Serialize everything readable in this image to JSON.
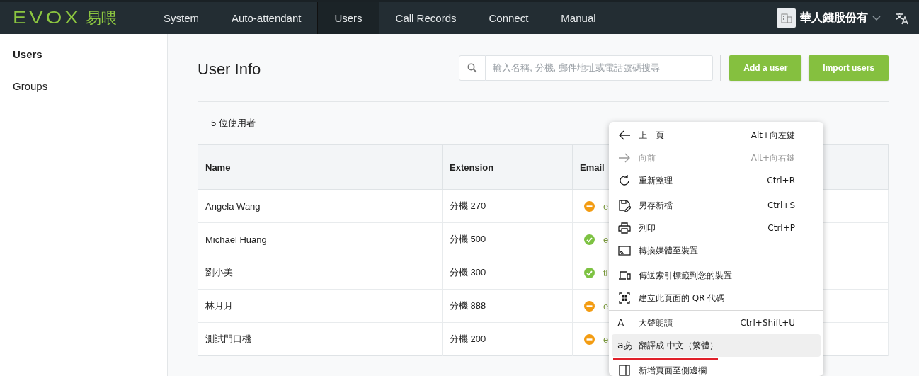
{
  "nav": {
    "logo": "EVOX",
    "logo_sub": "易喂",
    "tabs": [
      {
        "label": "System",
        "selected": false
      },
      {
        "label": "Auto-attendant",
        "selected": false
      },
      {
        "label": "Users",
        "selected": true
      },
      {
        "label": "Call Records",
        "selected": false
      },
      {
        "label": "Connect",
        "selected": false
      },
      {
        "label": "Manual",
        "selected": false
      }
    ],
    "company": "華人錢股份有"
  },
  "sidebar": {
    "items": [
      {
        "label": "Users",
        "selected": true
      },
      {
        "label": "Groups",
        "selected": false
      }
    ]
  },
  "page": {
    "title": "User Info",
    "search": {
      "placeholder": "輸入名稱, 分機, 郵件地址或電話號碼搜尋"
    },
    "buttons": [
      "Add a user",
      "Import users"
    ],
    "count": "5 位使用者",
    "table": {
      "columns": [
        "Name",
        "Extension",
        "Email"
      ],
      "rows": [
        {
          "name": "Angela Wang",
          "extension": "分機 270",
          "kind": "away",
          "email": "e"
        },
        {
          "name": "Michael Huang",
          "extension": "分機 500",
          "kind": "ok",
          "email": "e"
        },
        {
          "name": "劉小美",
          "extension": "分機 300",
          "kind": "ok",
          "email": "tl"
        },
        {
          "name": "林月月",
          "extension": "分機 888",
          "kind": "away",
          "email": "e"
        },
        {
          "name": "測試門口機",
          "extension": "分機 200",
          "kind": "away",
          "email": "e"
        }
      ]
    }
  },
  "context_menu": {
    "groups": [
      [
        {
          "kind": "back",
          "label": "上一頁",
          "shortcut": "Alt+向左鍵",
          "disabled": false,
          "highlighted": false
        },
        {
          "kind": "forward",
          "label": "向前",
          "shortcut": "Alt+向右鍵",
          "disabled": true,
          "highlighted": false
        },
        {
          "kind": "refresh",
          "label": "重新整理",
          "shortcut": "Ctrl+R",
          "disabled": false,
          "highlighted": false
        }
      ],
      [
        {
          "kind": "save",
          "label": "另存新檔",
          "shortcut": "Ctrl+S",
          "disabled": false,
          "highlighted": false
        },
        {
          "kind": "print",
          "label": "列印",
          "shortcut": "Ctrl+P",
          "disabled": false,
          "highlighted": false
        },
        {
          "kind": "cast",
          "label": "轉換媒體至裝置",
          "disabled": false,
          "highlighted": false
        }
      ],
      [
        {
          "kind": "devices",
          "label": "傳送索引標籤到您的裝置",
          "disabled": false,
          "highlighted": false
        },
        {
          "kind": "qr",
          "label": "建立此頁面的 QR 代碼",
          "disabled": false,
          "highlighted": false
        }
      ],
      [
        {
          "kind": "read",
          "glyph": "A",
          "label": "大聲朗讀",
          "shortcut": "Ctrl+Shift+U",
          "disabled": false,
          "highlighted": false
        },
        {
          "kind": "translate",
          "glyph": "aあ",
          "label": "翻譯成 中文（繁體）",
          "disabled": false,
          "highlighted": true,
          "underlined": true
        }
      ],
      [
        {
          "kind": "sidebar",
          "label": "新增頁面至側邊欄",
          "disabled": false,
          "highlighted": false
        }
      ]
    ]
  }
}
